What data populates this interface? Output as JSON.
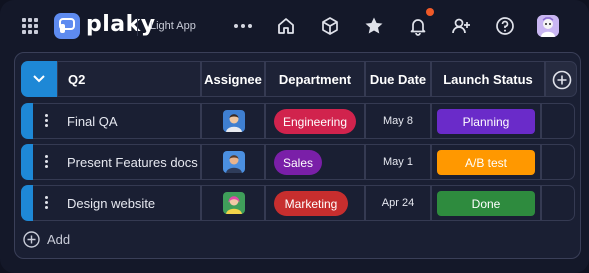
{
  "app": {
    "brand": "plaky",
    "theme_label": "Light App"
  },
  "colors": {
    "accent_blue": "#1e88d6",
    "logo_blue": "#5e8bf0",
    "notification": "#f05a28"
  },
  "icons": {
    "topbar": [
      "grid-icon",
      "more-icon",
      "home-icon",
      "cube-icon",
      "star-icon",
      "bell-icon",
      "add-user-icon",
      "help-icon"
    ]
  },
  "board": {
    "group_name": "Q2",
    "columns": {
      "assignee": "Assignee",
      "department": "Department",
      "due_date": "Due Date",
      "launch_status": "Launch Status"
    },
    "rows": [
      {
        "name": "Final QA",
        "department": "Engineering",
        "department_color": "#d1234d",
        "due_date": "May 8",
        "status": "Planning",
        "status_color": "#6a2bc9",
        "status_text_color": "#ffffff"
      },
      {
        "name": "Present Features docs",
        "department": "Sales",
        "department_color": "#7a1fa8",
        "due_date": "May 1",
        "status": "A/B test",
        "status_color": "#ff9800",
        "status_text_color": "#ffffff"
      },
      {
        "name": "Design website",
        "department": "Marketing",
        "department_color": "#c72e2e",
        "due_date": "Apr 24",
        "status": "Done",
        "status_color": "#2e8b3e",
        "status_text_color": "#ffffff"
      }
    ],
    "add_label": "Add"
  }
}
